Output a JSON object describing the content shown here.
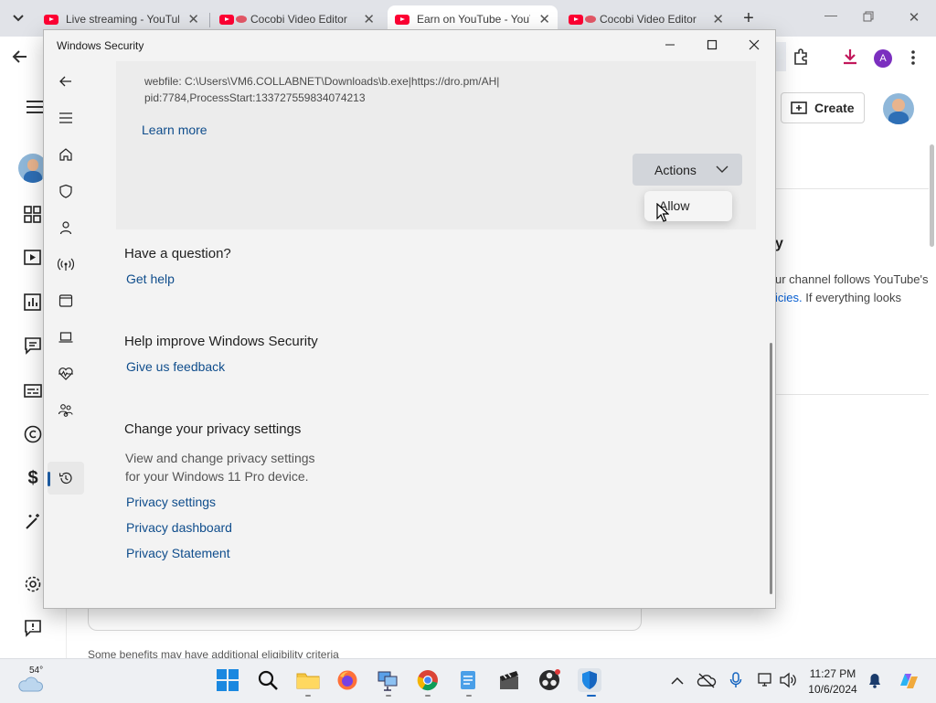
{
  "browser": {
    "tabs": [
      {
        "title": "Live streaming - YouTube",
        "icon": "youtube-icon"
      },
      {
        "title": "Cocobi Video Editor",
        "icon": "youtube-icon"
      },
      {
        "title": "Earn on YouTube - YouTube",
        "icon": "youtube-icon"
      },
      {
        "title": "Cocobi Video Editor",
        "icon": "youtube-icon"
      }
    ],
    "profile_initial": "A"
  },
  "studio": {
    "create_label": "Create",
    "right_heading": "y",
    "right_text_line1": "ur channel follows YouTube's",
    "right_text_line2_link": "icies.",
    "right_text_line2": " If everything looks",
    "footer_note": "Some benefits may have additional eligibility criteria"
  },
  "windows_security": {
    "title": "Windows Security",
    "detail_line1": "webfile: C:\\Users\\VM6.COLLABNET\\Downloads\\b.exe|https://dro.pm/AH|",
    "detail_line2": "pid:7784,ProcessStart:133727559834074213",
    "learn_more": "Learn more",
    "actions_label": "Actions",
    "menu_allow": "Allow",
    "question_heading": "Have a question?",
    "get_help": "Get help",
    "improve_heading": "Help improve Windows Security",
    "feedback_link": "Give us feedback",
    "privacy_heading": "Change your privacy settings",
    "privacy_desc_line1": "View and change privacy settings",
    "privacy_desc_line2": "for your Windows 11 Pro device.",
    "privacy_links": [
      "Privacy settings",
      "Privacy dashboard",
      "Privacy Statement"
    ]
  },
  "taskbar": {
    "weather_temp": "54°",
    "time": "11:27 PM",
    "date": "10/6/2024"
  },
  "colors": {
    "accent": "#0f4d8c",
    "youtube_red": "#ff0033"
  }
}
